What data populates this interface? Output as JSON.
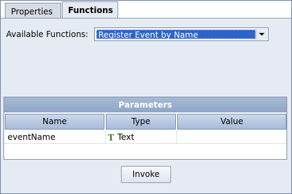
{
  "tabs": [
    {
      "label": "Properties",
      "active": false
    },
    {
      "label": "Functions",
      "active": true
    }
  ],
  "functions": {
    "label": "Available Functions:",
    "selected": "Register Event by Name"
  },
  "parameters": {
    "title": "Parameters",
    "columns": [
      "Name",
      "Type",
      "Value"
    ],
    "rows": [
      {
        "name": "eventName",
        "type": "Text",
        "type_icon": "text-type-icon",
        "value": ""
      }
    ]
  },
  "invoke_label": "Invoke",
  "colors": {
    "selection": "#2e63c8",
    "panel_bg": "#e6eaf2",
    "header_gradient_top": "#a7bad6",
    "text_icon": "#3a7a1e"
  }
}
